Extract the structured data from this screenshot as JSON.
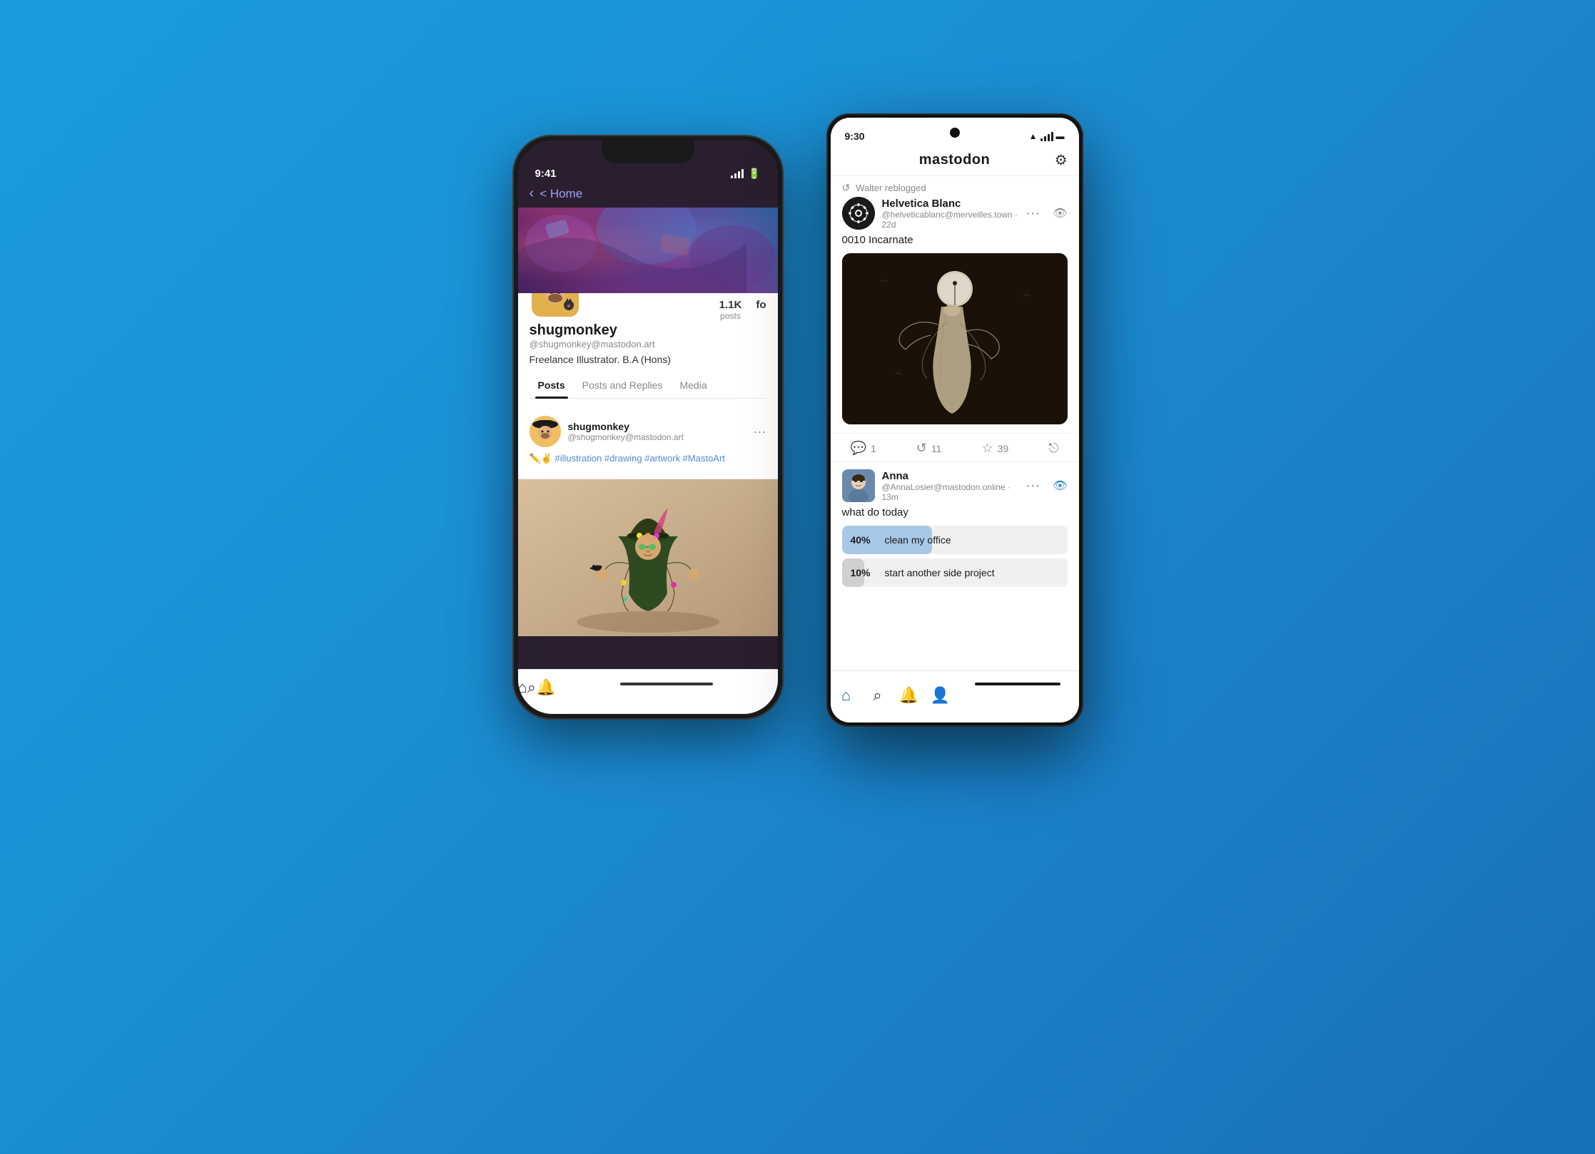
{
  "background": {
    "gradient_start": "#1a9de0",
    "gradient_end": "#1870b8"
  },
  "phone_left": {
    "status_time": "9:41",
    "header": {
      "back_label": "< Home"
    },
    "profile": {
      "username": "shugmonkey",
      "handle": "@shugmonkey@mastodon.art",
      "bio": "Freelance Illustrator. B.A (Hons)",
      "posts_count": "1.1K",
      "posts_label": "posts",
      "followers_label": "fo",
      "avatar_emoji": "🎨"
    },
    "tabs": [
      {
        "label": "Posts",
        "active": true
      },
      {
        "label": "Posts and Replies",
        "active": false
      },
      {
        "label": "Media",
        "active": false
      }
    ],
    "post": {
      "username": "shugmonkey",
      "handle": "@shugmonkey@mastodon.art",
      "text": "✏️✌️ #illustration #drawing #artwork #MastoArt",
      "avatar_emoji": "🤠"
    },
    "bottom_nav": [
      {
        "icon": "⌂",
        "label": "home"
      },
      {
        "icon": "⌕",
        "label": "search"
      },
      {
        "icon": "🔔",
        "label": "notifications"
      }
    ]
  },
  "phone_right": {
    "status_time": "9:30",
    "app_title": "mastodon",
    "reblog_text": "Walter reblogged",
    "post1": {
      "username": "Helvetica Blanc",
      "handle": "@helveticablanc@merveilles.town",
      "time": "22d",
      "text": "0010 Incarnate",
      "more_icon": "···",
      "eye_icon": "👁"
    },
    "post1_actions": {
      "comments": "1",
      "boosts": "11",
      "favorites": "39",
      "share_icon": "share"
    },
    "post2": {
      "username": "Anna",
      "handle": "@AnnaLosier@mastodon.online",
      "time": "13m",
      "more_icon": "···",
      "eye_icon": "👁",
      "text": "what do today"
    },
    "poll": {
      "option1": {
        "pct": "40%",
        "label": "clean my office",
        "fill": 40
      },
      "option2": {
        "pct": "10%",
        "label": "start another side project",
        "fill": 10
      }
    },
    "bottom_nav": [
      {
        "icon": "⌂",
        "label": "home",
        "active": true
      },
      {
        "icon": "⌕",
        "label": "search",
        "active": false
      },
      {
        "icon": "🔔",
        "label": "notifications",
        "active": false
      },
      {
        "icon": "👤",
        "label": "profile",
        "active": false
      }
    ]
  }
}
